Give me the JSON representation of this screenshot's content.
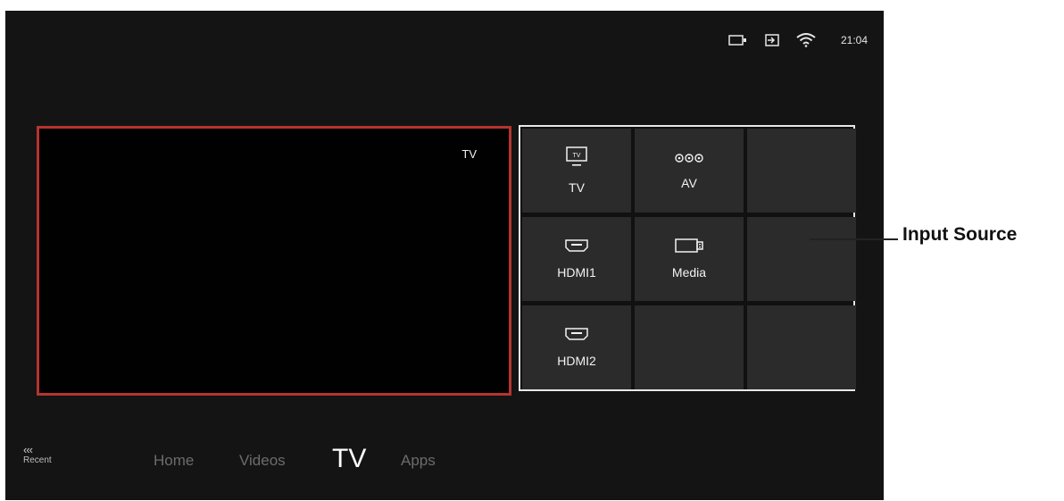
{
  "status": {
    "icons": [
      "screen-icon",
      "input-icon",
      "wifi-icon"
    ],
    "time": "21:04"
  },
  "preview": {
    "label": "TV"
  },
  "input_source": {
    "tiles": [
      {
        "label": "TV",
        "icon": "tv-icon"
      },
      {
        "label": "AV",
        "icon": "av-icon"
      },
      {
        "label": "",
        "icon": ""
      },
      {
        "label": "HDMI1",
        "icon": "hdmi-icon"
      },
      {
        "label": "Media",
        "icon": "usb-icon"
      },
      {
        "label": "",
        "icon": ""
      },
      {
        "label": "HDMI2",
        "icon": "hdmi-icon"
      },
      {
        "label": "",
        "icon": ""
      },
      {
        "label": "",
        "icon": ""
      }
    ]
  },
  "nav": {
    "recent_label": "Recent",
    "items": [
      "Home",
      "Videos",
      "TV",
      "Apps"
    ],
    "active": "TV"
  },
  "annotation": {
    "label": "Input Source"
  },
  "colors": {
    "preview_border": "#b53430",
    "panel_border": "#e8e8e8",
    "tile_bg": "#2b2b2b",
    "screen_bg": "#141414"
  }
}
